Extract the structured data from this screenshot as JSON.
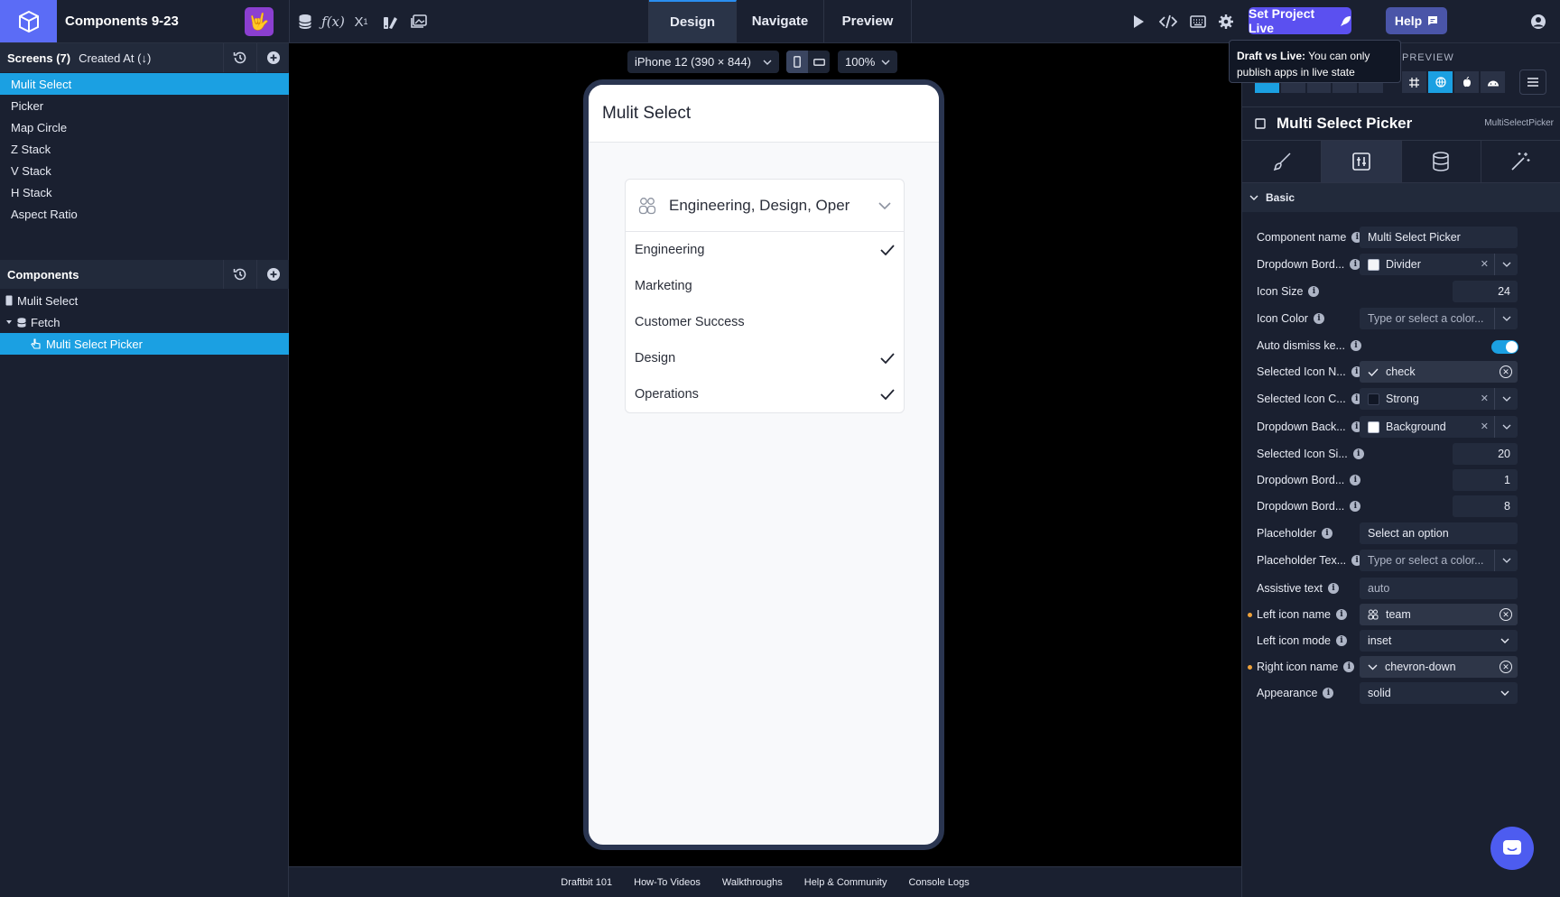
{
  "app": {
    "project_title": "Components 9-23",
    "avatar_emoji": "🤟",
    "mode_tabs": [
      {
        "label": "Design",
        "active": true
      },
      {
        "label": "Navigate",
        "active": false
      },
      {
        "label": "Preview",
        "active": false
      }
    ],
    "set_live_label": "Set Project Live",
    "help_label": "Help",
    "tooltip_title": "Draft vs Live:",
    "tooltip_text": "You can only publish apps in live state",
    "accent_color": "#1ba0e2",
    "brand_color": "#5b50f0"
  },
  "screens": {
    "header_title": "Screens (7)",
    "sort_label": "Created At (↓)",
    "items": [
      "Mulit Select",
      "Picker",
      "Map Circle",
      "Z Stack",
      "V Stack",
      "H Stack",
      "Aspect Ratio"
    ],
    "selected_index": 0
  },
  "components": {
    "header_title": "Components",
    "items": [
      {
        "label": "Mulit Select",
        "icon": "phone-icon"
      },
      {
        "label": "Fetch",
        "icon": "database-icon"
      },
      {
        "label": "Multi Select Picker",
        "icon": "picker-icon"
      }
    ]
  },
  "canvas": {
    "device": "iPhone 12 (390 × 844)",
    "zoom": "100%",
    "screen_title": "Mulit Select",
    "picker_value": "Engineering, Design, Oper",
    "options": [
      {
        "label": "Engineering",
        "checked": true
      },
      {
        "label": "Marketing",
        "checked": false
      },
      {
        "label": "Customer Success",
        "checked": false
      },
      {
        "label": "Design",
        "checked": true
      },
      {
        "label": "Operations",
        "checked": true
      }
    ]
  },
  "footer": {
    "links": [
      "Draftbit 101",
      "How-To Videos",
      "Walkthroughs",
      "Help & Community",
      "Console Logs"
    ]
  },
  "inspector": {
    "preview_label": "PREVIEW",
    "component_title": "Multi Select Picker",
    "component_type": "MultiSelectPicker",
    "section_label": "Basic",
    "props": {
      "component_name": {
        "label": "Component name",
        "value": "Multi Select Picker"
      },
      "dropdown_border_color": {
        "label": "Dropdown Bord...",
        "value": "Divider"
      },
      "icon_size": {
        "label": "Icon Size",
        "value": "24"
      },
      "icon_color": {
        "label": "Icon Color",
        "placeholder": "Type or select a color..."
      },
      "auto_dismiss": {
        "label": "Auto dismiss ke...",
        "on": true
      },
      "selected_icon_name": {
        "label": "Selected Icon N...",
        "value": "check"
      },
      "selected_icon_color": {
        "label": "Selected Icon C...",
        "value": "Strong"
      },
      "dropdown_background": {
        "label": "Dropdown Back...",
        "value": "Background"
      },
      "selected_icon_size": {
        "label": "Selected Icon Si...",
        "value": "20"
      },
      "dropdown_border_width": {
        "label": "Dropdown Bord...",
        "value": "1"
      },
      "dropdown_border_radius": {
        "label": "Dropdown Bord...",
        "value": "8"
      },
      "placeholder": {
        "label": "Placeholder",
        "value": "Select an option"
      },
      "placeholder_text_color": {
        "label": "Placeholder Tex...",
        "placeholder": "Type or select a color..."
      },
      "assistive_text": {
        "label": "Assistive text",
        "placeholder": "auto"
      },
      "left_icon_name": {
        "label": "Left icon name",
        "value": "team"
      },
      "left_icon_mode": {
        "label": "Left icon mode",
        "value": "inset"
      },
      "right_icon_name": {
        "label": "Right icon name",
        "value": "chevron-down"
      },
      "appearance": {
        "label": "Appearance",
        "value": "solid"
      }
    }
  }
}
